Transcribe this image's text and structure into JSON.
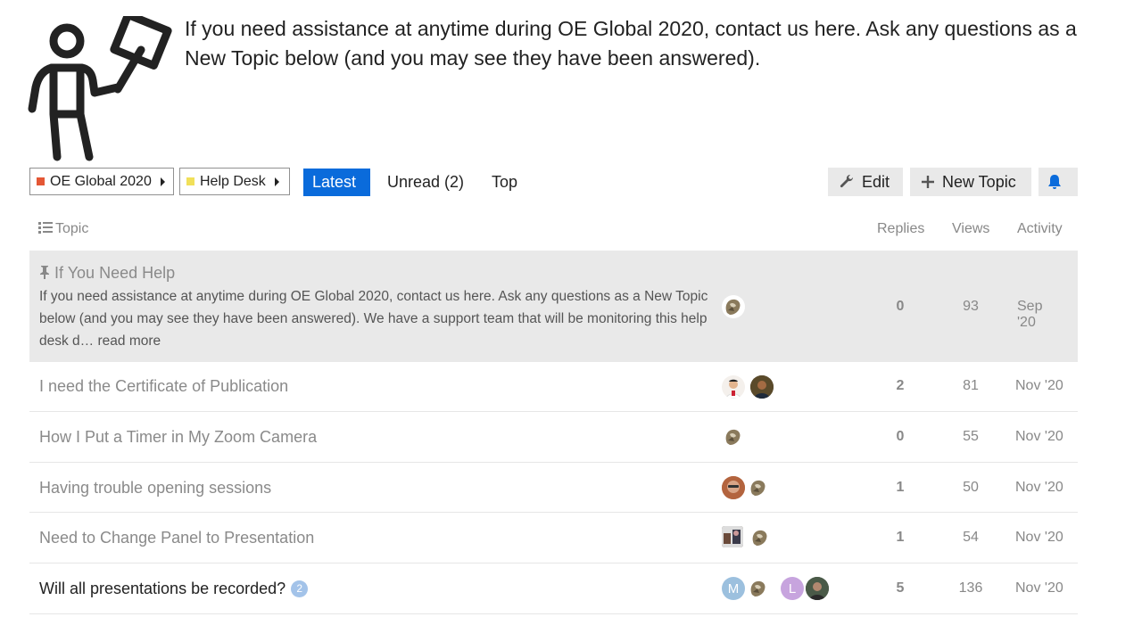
{
  "hero": {
    "text": "If you need assistance at anytime during OE Global 2020, contact us here. Ask any questions as a New Topic below (and you may see they have been answered)."
  },
  "nav": {
    "crumbs": [
      {
        "label": "OE Global 2020",
        "color": "#e45735"
      },
      {
        "label": "Help Desk",
        "color": "#f1e05a"
      }
    ],
    "tabs": {
      "latest": "Latest",
      "unread": "Unread (2)",
      "top": "Top"
    },
    "edit": "Edit",
    "new_topic": "New Topic"
  },
  "table": {
    "headers": {
      "topic": "Topic",
      "replies": "Replies",
      "views": "Views",
      "activity": "Activity"
    },
    "pinned": {
      "title": "If You Need Help",
      "excerpt": "If you need assistance at anytime during OE Global 2020, contact us here. Ask any questions as a New Topic below (and you may see they have been answered). We have a support team that will be monitoring this help desk d…",
      "read_more": "read more",
      "replies": "0",
      "views": "93",
      "activity": "Sep '20"
    },
    "rows": [
      {
        "title": "I need the Certificate of Publication",
        "replies": "2",
        "views": "81",
        "activity": "Nov '20"
      },
      {
        "title": "How I Put a Timer in My Zoom Camera",
        "replies": "0",
        "views": "55",
        "activity": "Nov '20"
      },
      {
        "title": "Having trouble opening sessions",
        "replies": "1",
        "views": "50",
        "activity": "Nov '20"
      },
      {
        "title": "Need to Change Panel to Presentation",
        "replies": "1",
        "views": "54",
        "activity": "Nov '20"
      },
      {
        "title": "Will all presentations be recorded?",
        "badge": "2",
        "replies": "5",
        "views": "136",
        "activity": "Nov '20"
      }
    ],
    "avatar_letters": {
      "m": "M",
      "l": "L"
    }
  }
}
